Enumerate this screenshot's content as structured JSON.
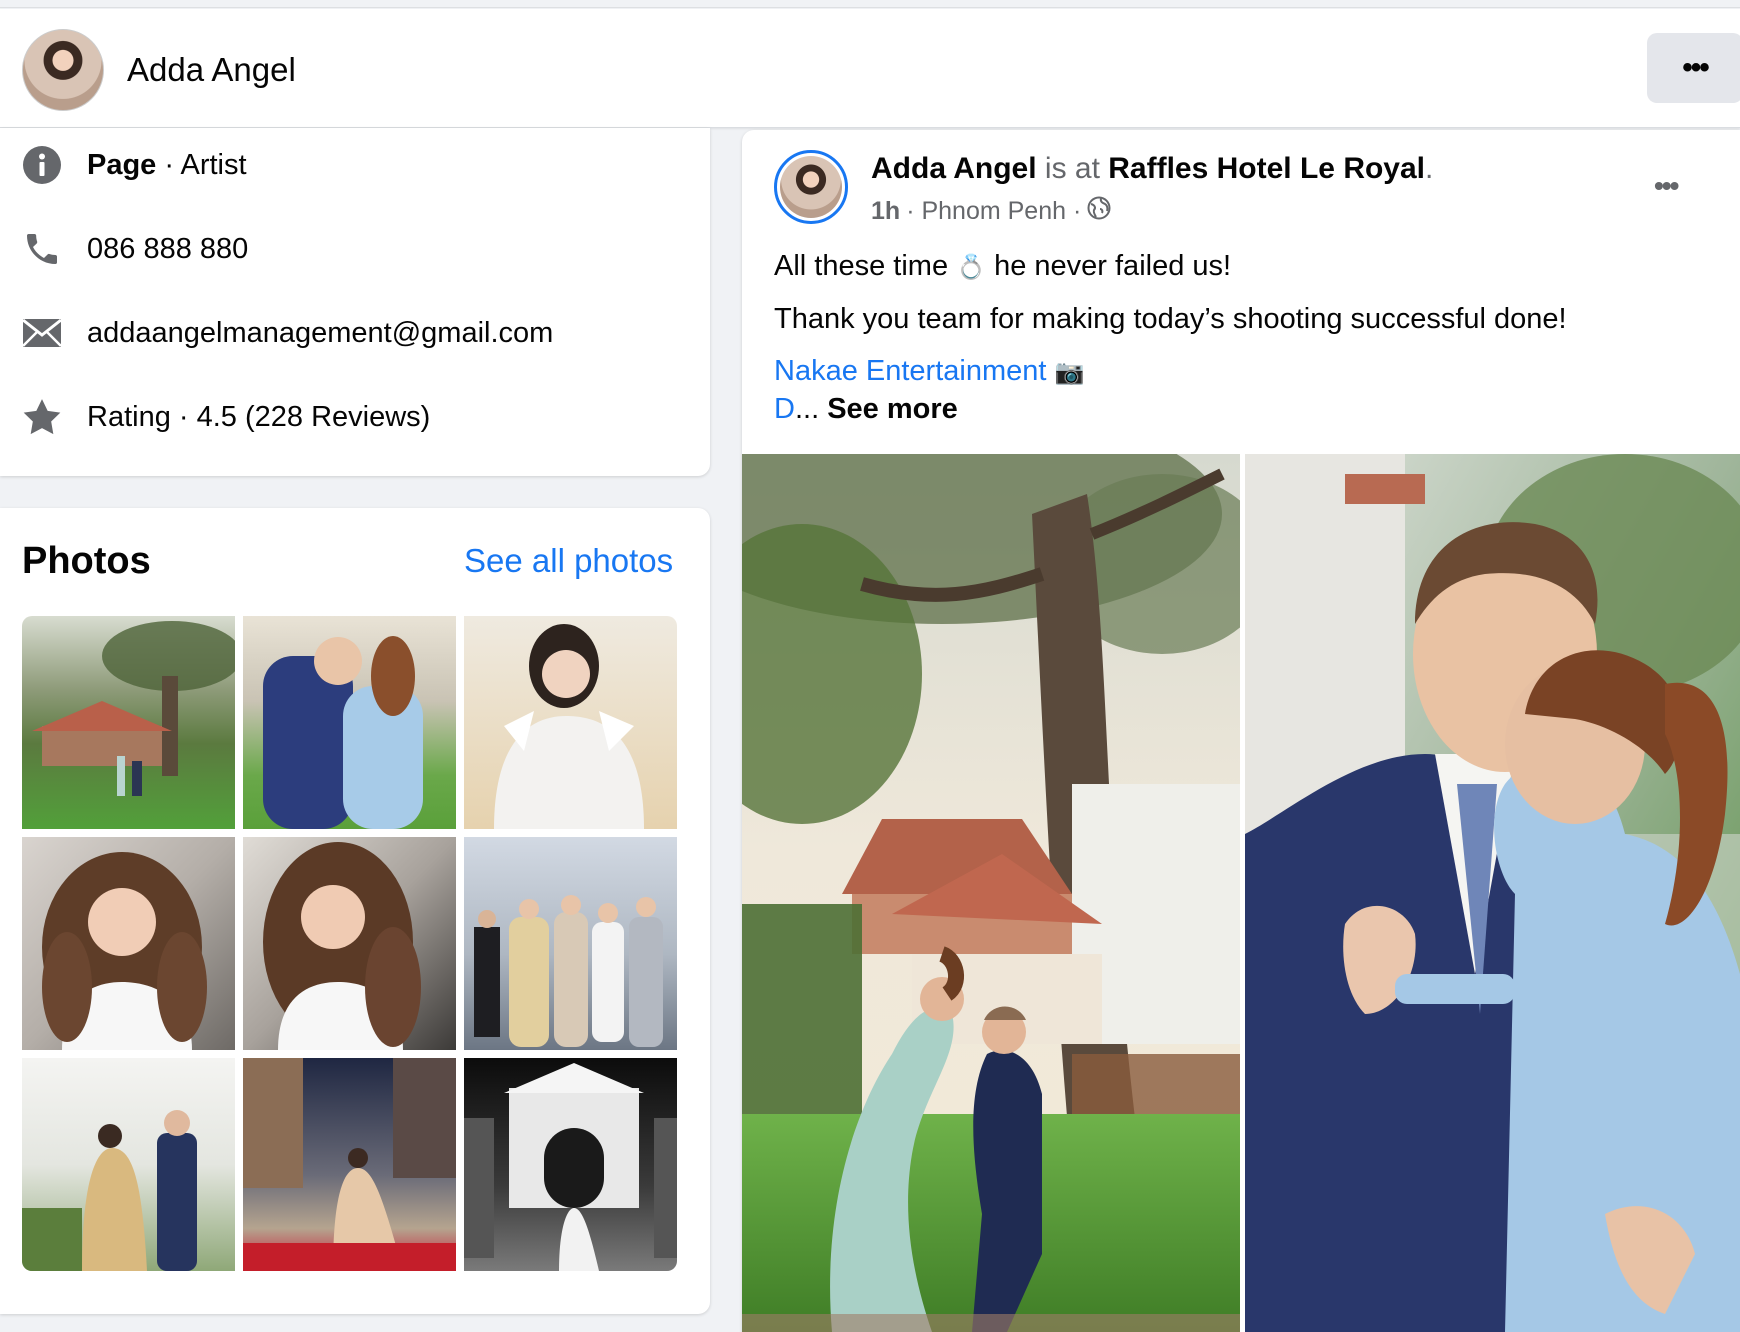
{
  "header": {
    "name": "Adda Angel",
    "more_label": "•••"
  },
  "intro": {
    "page_label": "Page",
    "page_category": " · Artist",
    "phone": "086 888 880",
    "email": "addaangelmanagement@gmail.com",
    "rating": "Rating · 4.5 (228 Reviews)"
  },
  "photos": {
    "title": "Photos",
    "see_all": "See all photos"
  },
  "post": {
    "author": "Adda Angel",
    "is_at": " is at ",
    "place": "Raffles Hotel Le Royal",
    "period": ".",
    "time": "1h",
    "location": " · Phnom Penh · ",
    "line1_a": "All these time ",
    "line1_emoji": "💍",
    "line1_b": " he never failed us!",
    "line2": "Thank you team for making today’s shooting successful done!",
    "mention": "Nakae Entertainment",
    "camera_emoji": "📷",
    "truncated": "D",
    "ellipsis": "... ",
    "see_more": "See more",
    "more_label": "•••"
  },
  "colors": {
    "accent": "#1877f2",
    "muted": "#65676b",
    "background": "#f0f2f5"
  },
  "icons": [
    "info-icon",
    "phone-icon",
    "mail-icon",
    "star-icon",
    "globe-icon",
    "more-icon"
  ]
}
